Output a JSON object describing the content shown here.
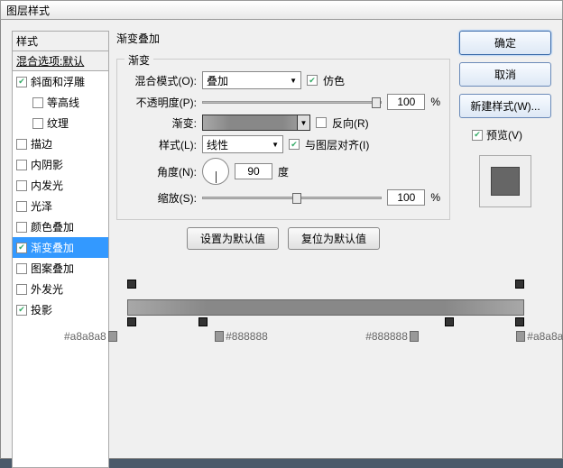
{
  "window": {
    "title": "图层样式"
  },
  "styles": {
    "header": "样式",
    "blend_defaults": "混合选项:默认",
    "items": [
      {
        "label": "斜面和浮雕",
        "checked": true,
        "indent": false
      },
      {
        "label": "等高线",
        "checked": false,
        "indent": true
      },
      {
        "label": "纹理",
        "checked": false,
        "indent": true
      },
      {
        "label": "描边",
        "checked": false,
        "indent": false
      },
      {
        "label": "内阴影",
        "checked": false,
        "indent": false
      },
      {
        "label": "内发光",
        "checked": false,
        "indent": false
      },
      {
        "label": "光泽",
        "checked": false,
        "indent": false
      },
      {
        "label": "颜色叠加",
        "checked": false,
        "indent": false
      },
      {
        "label": "渐变叠加",
        "checked": true,
        "indent": false,
        "selected": true
      },
      {
        "label": "图案叠加",
        "checked": false,
        "indent": false
      },
      {
        "label": "外发光",
        "checked": false,
        "indent": false
      },
      {
        "label": "投影",
        "checked": true,
        "indent": false
      }
    ]
  },
  "main": {
    "panel_title": "渐变叠加",
    "group_title": "渐变",
    "blend_mode_label": "混合模式(O):",
    "blend_mode_value": "叠加",
    "dither_label": "仿色",
    "opacity_label": "不透明度(P):",
    "opacity_value": "100",
    "opacity_unit": "%",
    "gradient_label": "渐变:",
    "reverse_label": "反向(R)",
    "style_label": "样式(L):",
    "style_value": "线性",
    "align_label": "与图层对齐(I)",
    "angle_label": "角度(N):",
    "angle_value": "90",
    "angle_unit": "度",
    "scale_label": "缩放(S):",
    "scale_value": "100",
    "scale_unit": "%",
    "reset_default": "设置为默认值",
    "restore_default": "复位为默认值"
  },
  "right": {
    "ok": "确定",
    "cancel": "取消",
    "new_style": "新建样式(W)...",
    "preview": "预览(V)"
  },
  "grad_stops": {
    "hex": [
      "#a8a8a8",
      "#888888",
      "#888888",
      "#a8a8a8"
    ]
  }
}
